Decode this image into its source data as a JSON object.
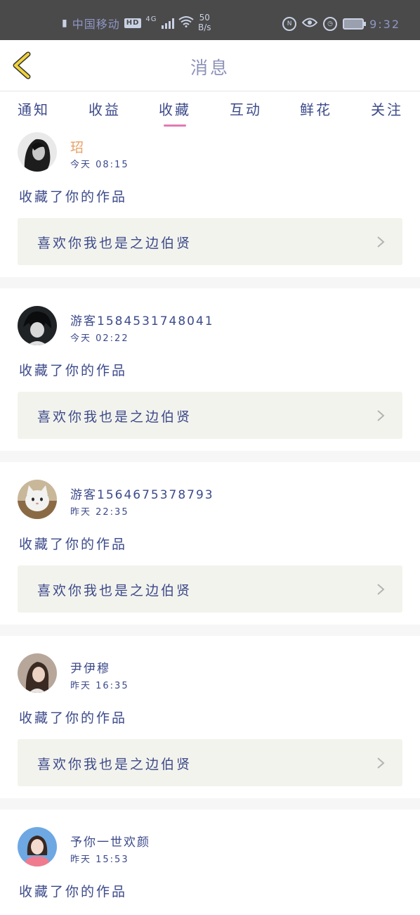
{
  "status_bar": {
    "carrier": "中国移动",
    "hd_badge": "HD",
    "network": "4G",
    "speed_value": "50",
    "speed_unit": "B/s",
    "time": "9:32",
    "icons": [
      "nfc-icon",
      "eye-icon",
      "alarm-icon",
      "battery-icon"
    ]
  },
  "header": {
    "title": "消息",
    "back_icon": "chevron-left-icon",
    "back_color": "#f2d33a"
  },
  "tabs": {
    "items": [
      "通知",
      "收益",
      "收藏",
      "互动",
      "鲜花",
      "关注"
    ],
    "active_index": 2,
    "active_color": "#e17ab4"
  },
  "messages": [
    {
      "user": "玿",
      "time": "今天 08:15",
      "action": "收藏了你的作品",
      "work": "喜欢你我也是之边伯贤",
      "name_color": "#e8a169",
      "avatar": "avatar-woman-dark-hair"
    },
    {
      "user": "游客1584531748041",
      "time": "今天 02:22",
      "action": "收藏了你的作品",
      "work": "喜欢你我也是之边伯贤",
      "avatar": "avatar-anime-boy"
    },
    {
      "user": "游客1564675378793",
      "time": "昨天 22:35",
      "action": "收藏了你的作品",
      "work": "喜欢你我也是之边伯贤",
      "avatar": "avatar-cat"
    },
    {
      "user": "尹伊穆",
      "time": "昨天 16:35",
      "action": "收藏了你的作品",
      "work": "喜欢你我也是之边伯贤",
      "avatar": "avatar-girl"
    },
    {
      "user": "予你一世欢颜",
      "time": "昨天 15:53",
      "action": "收藏了你的作品",
      "work": "",
      "avatar": "avatar-girl-pink"
    }
  ],
  "colors": {
    "text": "#3c4a8a",
    "card_bg": "#f3f3ed",
    "divider": "#f6f6f6",
    "status_bar_bg": "#4a4a4a"
  }
}
